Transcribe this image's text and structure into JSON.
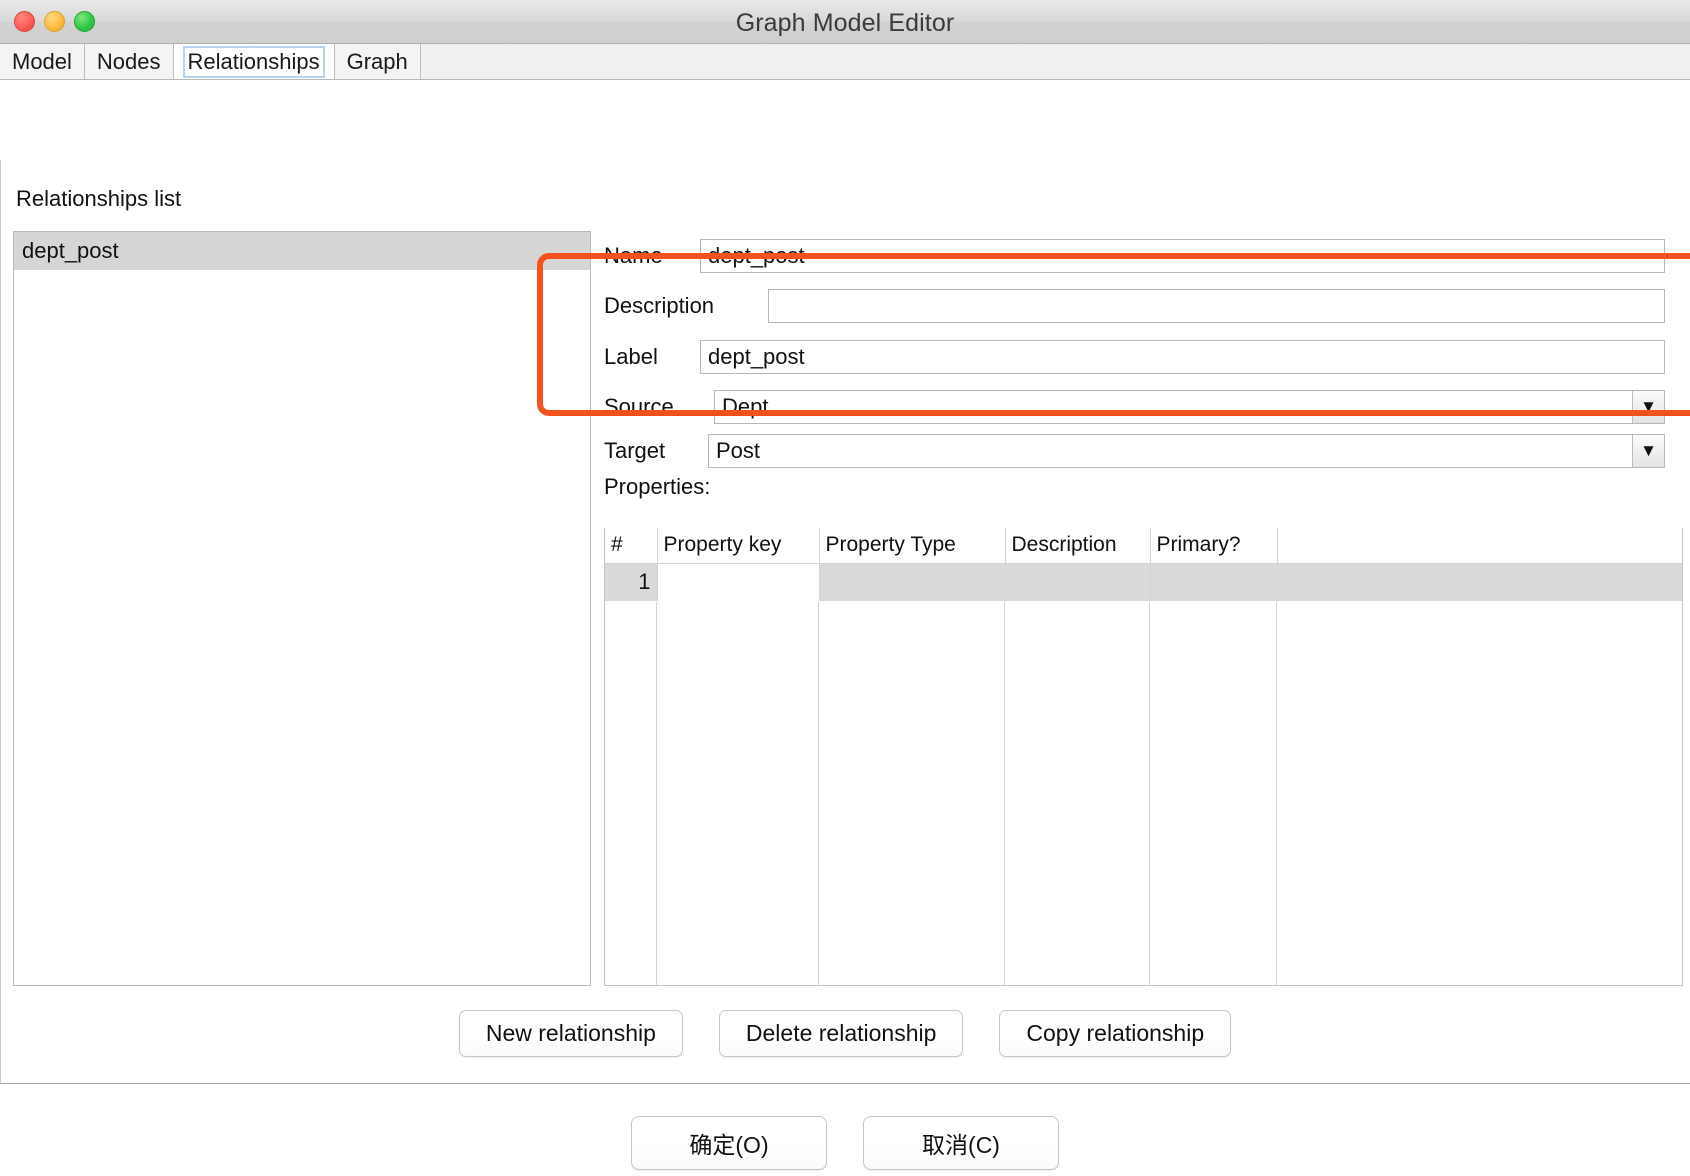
{
  "window": {
    "title": "Graph Model Editor",
    "controls": [
      "close-button",
      "minimize-button",
      "maximize-button"
    ]
  },
  "tabs": [
    {
      "label": "Model",
      "selected": false
    },
    {
      "label": "Nodes",
      "selected": false
    },
    {
      "label": "Relationships",
      "selected": true
    },
    {
      "label": "Graph",
      "selected": false
    }
  ],
  "list_panel": {
    "title": "Relationships list",
    "items": [
      {
        "label": "dept_post",
        "selected": true
      }
    ]
  },
  "form": {
    "name": {
      "label": "Name",
      "value": "dept_post",
      "placeholder": ""
    },
    "description": {
      "label": "Description",
      "value": "",
      "placeholder": ""
    },
    "label_field": {
      "label": "Label",
      "value": "dept_post",
      "placeholder": ""
    },
    "source": {
      "label": "Source",
      "value": "Dept",
      "arrow": "▼"
    },
    "target": {
      "label": "Target",
      "value": "Post",
      "arrow": "▼"
    }
  },
  "properties": {
    "caption": "Properties:",
    "columns": [
      "#",
      "Property key",
      "Property Type",
      "Description",
      "Primary?",
      ""
    ],
    "rows": [
      {
        "num": "1",
        "property_key": "",
        "property_type": "",
        "description": "",
        "primary": "",
        "extra": ""
      }
    ]
  },
  "actions": {
    "new": "New relationship",
    "delete": "Delete relationship",
    "copy": "Copy relationship"
  },
  "dialog_buttons": {
    "ok": "确定(O)",
    "cancel": "取消(C)"
  },
  "annotation": {
    "color": "#f4511e",
    "shape": "rounded-rectangle"
  }
}
